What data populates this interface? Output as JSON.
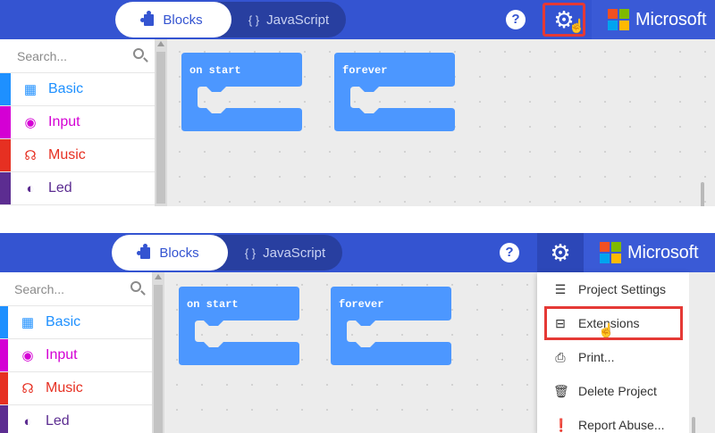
{
  "header": {
    "blocks_label": "Blocks",
    "javascript_label": "JavaScript",
    "js_glyph": "{ }",
    "help_glyph": "?",
    "brand": "Microsoft",
    "colors": {
      "bar": "#3454d1",
      "toggle": "#283fa0",
      "highlight": "#e53935"
    },
    "ms_logo_colors": [
      "#f25022",
      "#7fba00",
      "#00a4ef",
      "#ffb900"
    ]
  },
  "sidebar": {
    "search_placeholder": "Search...",
    "categories": [
      {
        "label": "Basic",
        "color": "#1e90ff",
        "icon": "grid-icon"
      },
      {
        "label": "Input",
        "color": "#d400d4",
        "icon": "target-icon"
      },
      {
        "label": "Music",
        "color": "#e63022",
        "icon": "headphones-icon"
      },
      {
        "label": "Led",
        "color": "#5c2d91",
        "icon": "toggle-icon"
      }
    ]
  },
  "workspace": {
    "blocks": [
      {
        "label": "on start",
        "color": "#4c97ff"
      },
      {
        "label": "forever",
        "color": "#4c97ff"
      }
    ]
  },
  "settings_menu": {
    "items": [
      {
        "label": "Project Settings",
        "icon": "sliders-icon"
      },
      {
        "label": "Extensions",
        "icon": "drawer-icon"
      },
      {
        "label": "Print...",
        "icon": "printer-icon"
      },
      {
        "label": "Delete Project",
        "icon": "trash-icon"
      },
      {
        "label": "Report Abuse...",
        "icon": "alert-icon"
      }
    ]
  }
}
